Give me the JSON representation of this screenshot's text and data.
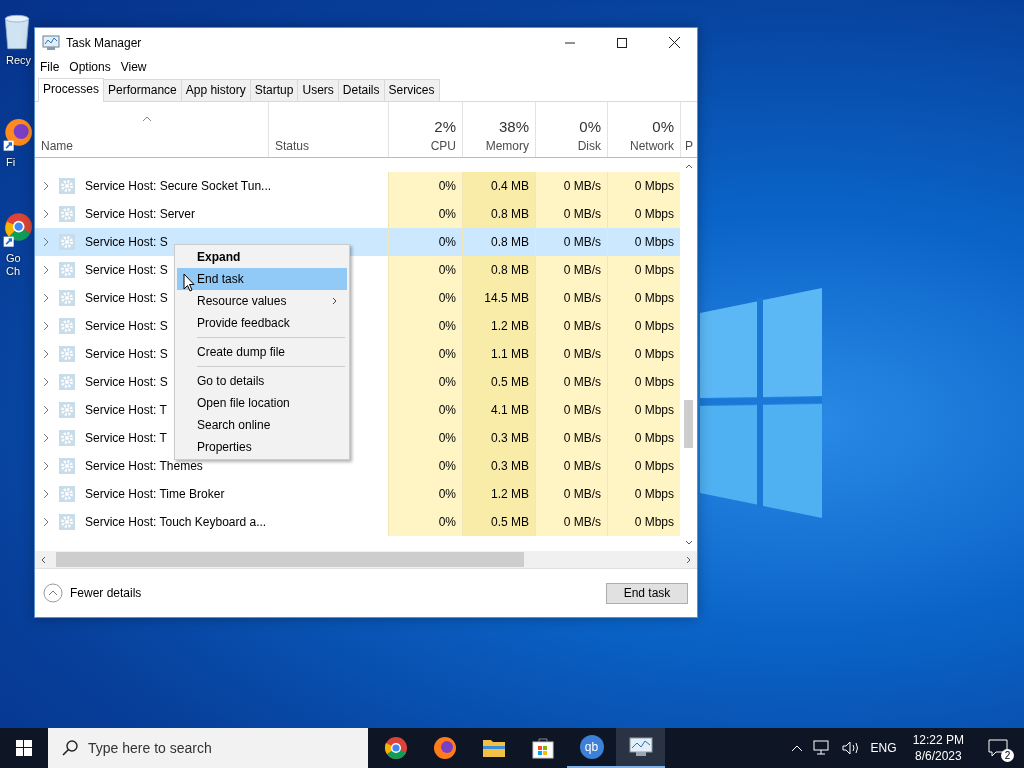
{
  "desktop": {
    "icons": [
      {
        "kind": "bin",
        "label_lines": [
          "Recy"
        ]
      },
      {
        "kind": "fox",
        "label_lines": [
          "Fi"
        ]
      },
      {
        "kind": "chrome",
        "label_lines": [
          "Go",
          "Ch"
        ]
      }
    ]
  },
  "window": {
    "title": "Task Manager",
    "menu": [
      "File",
      "Options",
      "View"
    ],
    "tabs": [
      {
        "label": "Processes",
        "selected": true
      },
      {
        "label": "Performance",
        "selected": false
      },
      {
        "label": "App history",
        "selected": false
      },
      {
        "label": "Startup",
        "selected": false
      },
      {
        "label": "Users",
        "selected": false
      },
      {
        "label": "Details",
        "selected": false
      },
      {
        "label": "Services",
        "selected": false
      }
    ],
    "columns": [
      {
        "label": "Name",
        "sorted": true
      },
      {
        "label": "Status",
        "sorted": false
      },
      {
        "total": "2%",
        "label": "CPU",
        "sorted": false,
        "color": "#fff4c4"
      },
      {
        "total": "38%",
        "label": "Memory",
        "sorted": false,
        "color": "#f9eba8"
      },
      {
        "total": "0%",
        "label": "Disk",
        "sorted": false,
        "color": "#fff4c4"
      },
      {
        "total": "0%",
        "label": "Network",
        "sorted": false,
        "color": "#fff4c4"
      },
      {
        "label": "P",
        "sorted": false
      }
    ],
    "rows": [
      {
        "name": "Service Host: Secure Socket Tun...",
        "cpu": "0%",
        "memory": "0.4 MB",
        "disk": "0 MB/s",
        "network": "0 Mbps",
        "selected": false
      },
      {
        "name": "Service Host: Server",
        "cpu": "0%",
        "memory": "0.8 MB",
        "disk": "0 MB/s",
        "network": "0 Mbps",
        "selected": false
      },
      {
        "name": "Service Host: S",
        "cpu": "0%",
        "memory": "0.8 MB",
        "disk": "0 MB/s",
        "network": "0 Mbps",
        "selected": true
      },
      {
        "name": "Service Host: S",
        "cpu": "0%",
        "memory": "0.8 MB",
        "disk": "0 MB/s",
        "network": "0 Mbps",
        "selected": false
      },
      {
        "name": "Service Host: S",
        "cpu": "0%",
        "memory": "14.5 MB",
        "disk": "0 MB/s",
        "network": "0 Mbps",
        "selected": false
      },
      {
        "name": "Service Host: S",
        "cpu": "0%",
        "memory": "1.2 MB",
        "disk": "0 MB/s",
        "network": "0 Mbps",
        "selected": false
      },
      {
        "name": "Service Host: S",
        "cpu": "0%",
        "memory": "1.1 MB",
        "disk": "0 MB/s",
        "network": "0 Mbps",
        "selected": false
      },
      {
        "name": "Service Host: S",
        "cpu": "0%",
        "memory": "0.5 MB",
        "disk": "0 MB/s",
        "network": "0 Mbps",
        "selected": false
      },
      {
        "name": "Service Host: T",
        "cpu": "0%",
        "memory": "4.1 MB",
        "disk": "0 MB/s",
        "network": "0 Mbps",
        "selected": false
      },
      {
        "name": "Service Host: T",
        "cpu": "0%",
        "memory": "0.3 MB",
        "disk": "0 MB/s",
        "network": "0 Mbps",
        "selected": false
      },
      {
        "name": "Service Host: Themes",
        "cpu": "0%",
        "memory": "0.3 MB",
        "disk": "0 MB/s",
        "network": "0 Mbps",
        "selected": false
      },
      {
        "name": "Service Host: Time Broker",
        "cpu": "0%",
        "memory": "1.2 MB",
        "disk": "0 MB/s",
        "network": "0 Mbps",
        "selected": false
      },
      {
        "name": "Service Host: Touch Keyboard a...",
        "cpu": "0%",
        "memory": "0.5 MB",
        "disk": "0 MB/s",
        "network": "0 Mbps",
        "selected": false
      }
    ],
    "footer": {
      "toggle": "Fewer details",
      "button": "End task"
    }
  },
  "context_menu": [
    {
      "kind": "item",
      "label": "Expand",
      "bold": true,
      "selected": false,
      "submenu": false
    },
    {
      "kind": "item",
      "label": "End task",
      "bold": false,
      "selected": true,
      "submenu": false
    },
    {
      "kind": "item",
      "label": "Resource values",
      "bold": false,
      "selected": false,
      "submenu": true
    },
    {
      "kind": "item",
      "label": "Provide feedback",
      "bold": false,
      "selected": false,
      "submenu": false
    },
    {
      "kind": "separator"
    },
    {
      "kind": "item",
      "label": "Create dump file",
      "bold": false,
      "selected": false,
      "submenu": false
    },
    {
      "kind": "separator"
    },
    {
      "kind": "item",
      "label": "Go to details",
      "bold": false,
      "selected": false,
      "submenu": false
    },
    {
      "kind": "item",
      "label": "Open file location",
      "bold": false,
      "selected": false,
      "submenu": false
    },
    {
      "kind": "item",
      "label": "Search online",
      "bold": false,
      "selected": false,
      "submenu": false
    },
    {
      "kind": "item",
      "label": "Properties",
      "bold": false,
      "selected": false,
      "submenu": false
    }
  ],
  "taskbar": {
    "search": {
      "placeholder": "Type here to search"
    },
    "apps": [
      {
        "kind": "chrome",
        "running": false,
        "active": false
      },
      {
        "kind": "fox",
        "running": false,
        "active": false
      },
      {
        "kind": "folder",
        "running": false,
        "active": false
      },
      {
        "kind": "store",
        "running": false,
        "active": false
      },
      {
        "kind": "qb",
        "label": "qb",
        "running": true,
        "active": false
      },
      {
        "kind": "monitor",
        "running": true,
        "active": true
      }
    ],
    "language": "ENG",
    "time": "12:22 PM",
    "date": "8/6/2023",
    "notifications": "2"
  }
}
